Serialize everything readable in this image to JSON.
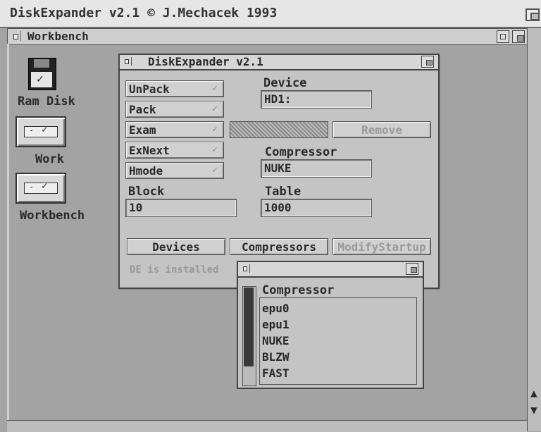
{
  "screen": {
    "title": "DiskExpander v2.1 © J.Mechacek 1993"
  },
  "workbench": {
    "title": "Workbench"
  },
  "icons": [
    {
      "label": "Ram Disk"
    },
    {
      "label": "Work"
    },
    {
      "label": "Workbench"
    }
  ],
  "diskexpander": {
    "title": "DiskExpander v2.1",
    "buttons": {
      "unpack": "UnPack",
      "pack": "Pack",
      "exam": "Exam",
      "exnext": "ExNext",
      "hmode": "Hmode"
    },
    "device_label": "Device",
    "device_value": "HD1:",
    "remove_label": "Remove",
    "compressor_label": "Compressor",
    "compressor_value": "NUKE",
    "block_label": "Block",
    "block_value": "10",
    "table_label": "Table",
    "table_value": "1000",
    "devices_label": "Devices",
    "compressors_label": "Compressors",
    "modifystartup_label": "ModifyStartup",
    "status": "DE is installed"
  },
  "compressor_list": {
    "header": "Compressor",
    "items": [
      "epu0",
      "epu1",
      "NUKE",
      "BLZW",
      "FAST"
    ]
  }
}
